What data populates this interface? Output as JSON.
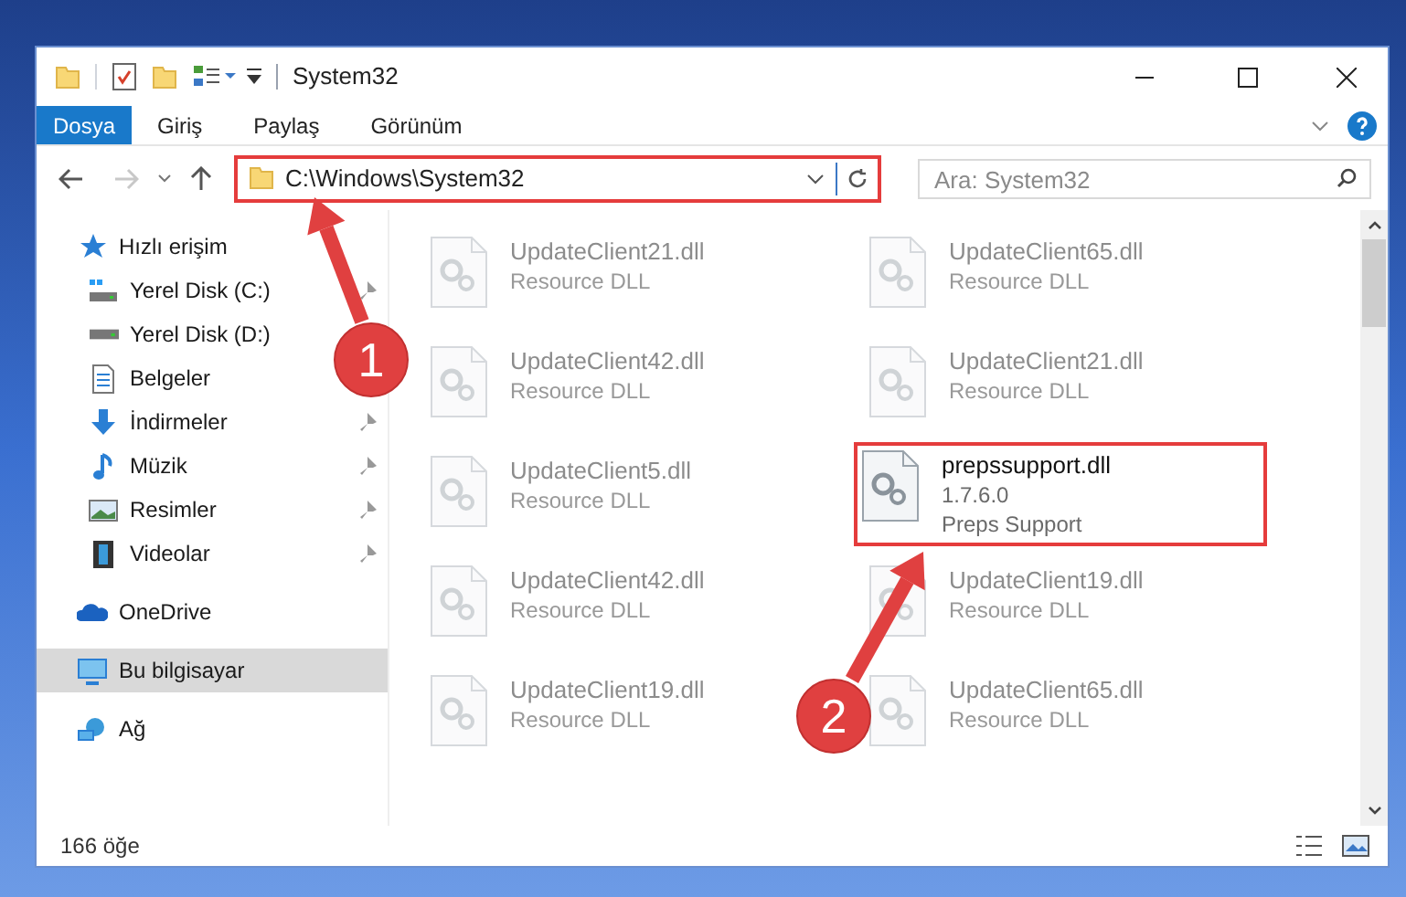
{
  "window": {
    "title": "System32"
  },
  "ribbon": {
    "tabs": [
      {
        "label": "Dosya",
        "kind": "file"
      },
      {
        "label": "Giriş",
        "kind": "tab"
      },
      {
        "label": "Paylaş",
        "kind": "tab"
      },
      {
        "label": "Görünüm",
        "kind": "tab"
      }
    ]
  },
  "address": {
    "path": "C:\\Windows\\System32",
    "highlighted": true
  },
  "search": {
    "placeholder": "Ara: System32"
  },
  "nav": {
    "items": [
      {
        "label": "Hızlı erişim",
        "selected": false,
        "children": [
          {
            "label": "Yerel Disk (C:)",
            "pinned": true
          },
          {
            "label": "Yerel Disk (D:)",
            "pinned": false
          },
          {
            "label": "Belgeler",
            "pinned": false
          },
          {
            "label": "İndirmeler",
            "pinned": true
          },
          {
            "label": "Müzik",
            "pinned": true
          },
          {
            "label": "Resimler",
            "pinned": true
          },
          {
            "label": "Videolar",
            "pinned": true
          }
        ]
      },
      {
        "label": "OneDrive",
        "selected": false
      },
      {
        "label": "Bu bilgisayar",
        "selected": true
      },
      {
        "label": "Ağ",
        "selected": false
      }
    ]
  },
  "files": [
    {
      "name": "UpdateClient21.dll",
      "lines": [
        "Resource DLL"
      ],
      "blurred": true,
      "highlighted": false
    },
    {
      "name": "UpdateClient65.dll",
      "lines": [
        "Resource DLL"
      ],
      "blurred": true,
      "highlighted": false
    },
    {
      "name": "UpdateClient42.dll",
      "lines": [
        "Resource DLL"
      ],
      "blurred": true,
      "highlighted": false
    },
    {
      "name": "UpdateClient21.dll",
      "lines": [
        "Resource DLL"
      ],
      "blurred": true,
      "highlighted": false
    },
    {
      "name": "UpdateClient5.dll",
      "lines": [
        "Resource DLL"
      ],
      "blurred": true,
      "highlighted": false
    },
    {
      "name": "prepssupport.dll",
      "lines": [
        "1.7.6.0",
        "Preps Support"
      ],
      "blurred": false,
      "highlighted": true
    },
    {
      "name": "UpdateClient42.dll",
      "lines": [
        "Resource DLL"
      ],
      "blurred": true,
      "highlighted": false
    },
    {
      "name": "UpdateClient19.dll",
      "lines": [
        "Resource DLL"
      ],
      "blurred": true,
      "highlighted": false
    },
    {
      "name": "UpdateClient19.dll",
      "lines": [
        "Resource DLL"
      ],
      "blurred": true,
      "highlighted": false
    },
    {
      "name": "UpdateClient65.dll",
      "lines": [
        "Resource DLL"
      ],
      "blurred": true,
      "highlighted": false
    }
  ],
  "status_bar": {
    "count": "166 öğe"
  },
  "annotations": [
    {
      "number": "1"
    },
    {
      "number": "2"
    }
  ]
}
